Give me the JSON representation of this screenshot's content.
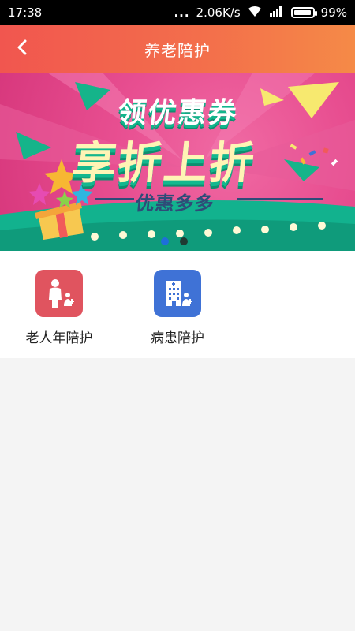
{
  "status_bar": {
    "time": "17:38",
    "speed": "2.06K/s",
    "battery": "99%",
    "battery_level": 0.99,
    "more_glyph": "..."
  },
  "header": {
    "title": "养老陪护",
    "back_icon": "chevron-left-icon"
  },
  "banner": {
    "line1": "领优惠券",
    "line2": "享折上折",
    "line3": "优惠多多",
    "indicator_count": 2,
    "active_index": 0
  },
  "services": [
    {
      "label": "老人年陪护",
      "icon": "elderly-person-add-icon",
      "color": "#e0545f"
    },
    {
      "label": "病患陪护",
      "icon": "hospital-building-add-icon",
      "color": "#3f72d6"
    }
  ],
  "colors": {
    "header_start": "#f1564f",
    "header_end": "#f58a47",
    "indicator_active": "#1e6fd9",
    "indicator_inactive": "#1f3b33"
  }
}
